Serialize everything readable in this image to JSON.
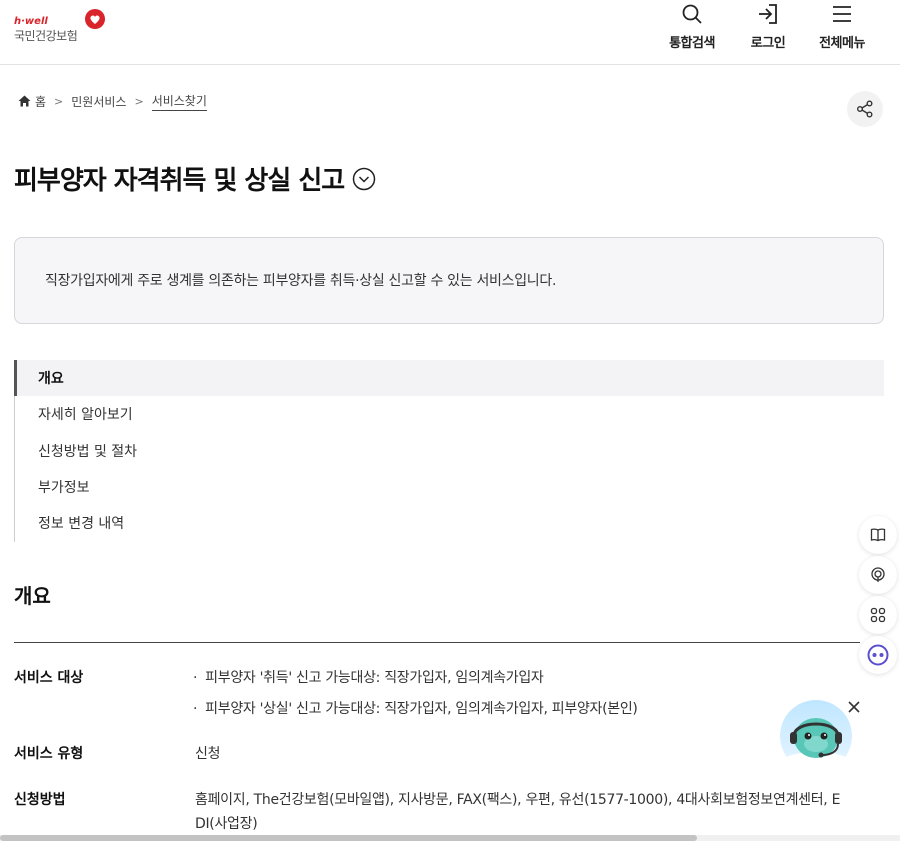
{
  "logo": {
    "eng": "h·well",
    "kor": "국민건강보험"
  },
  "header": {
    "search_label": "통합검색",
    "login_label": "로그인",
    "menu_label": "전체메뉴"
  },
  "breadcrumb": {
    "home": "홈",
    "level1": "민원서비스",
    "level2": "서비스찾기"
  },
  "page": {
    "title": "피부양자 자격취득 및 상실 신고",
    "summary": "직장가입자에게 주로 생계를 의존하는 피부양자를 취득·상실 신고할 수 있는 서비스입니다."
  },
  "toc": {
    "items": [
      {
        "label": "개요"
      },
      {
        "label": "자세히 알아보기"
      },
      {
        "label": "신청방법 및 절차"
      },
      {
        "label": "부가정보"
      },
      {
        "label": "정보 변경 내역"
      }
    ]
  },
  "overview": {
    "title": "개요",
    "target_label": "서비스 대상",
    "target_items": [
      "피부양자 '취득' 신고 가능대상: 직장가입자, 임의계속가입자",
      "피부양자 '상실' 신고 가능대상: 직장가입자, 임의계속가입자, 피부양자(본인)"
    ],
    "type_label": "서비스 유형",
    "type_value": "신청",
    "method_label": "신청방법",
    "method_line1": "홈페이지, The건강보험(모바일앱), 지사방문, FAX(팩스), 우편, 유선(1577-1000), 4대사회보험정보연계센터, E",
    "method_line2": "DI(사업장)"
  },
  "colors": {
    "brand": "#d9242c",
    "text": "#222222",
    "chatbot_accent": "#5a4fcf"
  }
}
